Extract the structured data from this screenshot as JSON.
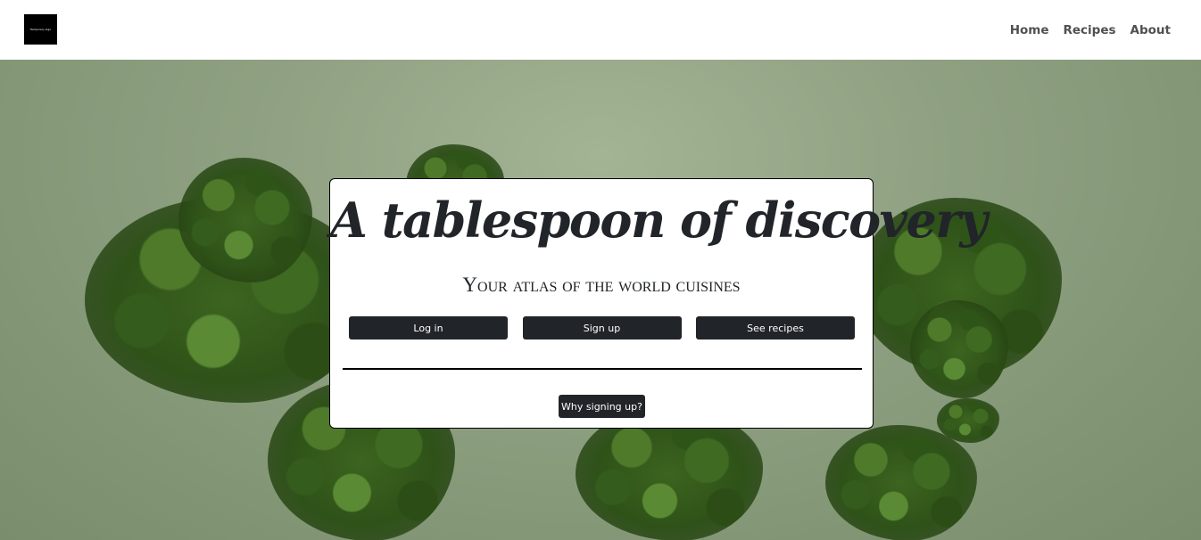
{
  "logo": {
    "text": "Temporary logo"
  },
  "nav": {
    "items": [
      {
        "label": "Home"
      },
      {
        "label": "Recipes"
      },
      {
        "label": "About"
      }
    ]
  },
  "hero": {
    "title": "A tablespoon of discovery",
    "tagline": "Your atlas of the world cuisines",
    "buttons": {
      "login": "Log in",
      "signup": "Sign up",
      "see_recipes": "See recipes"
    },
    "why_button": "Why signing up?"
  },
  "colors": {
    "button_bg": "#212529",
    "nav_text": "#505050",
    "hero_bg": "#8fa182"
  }
}
